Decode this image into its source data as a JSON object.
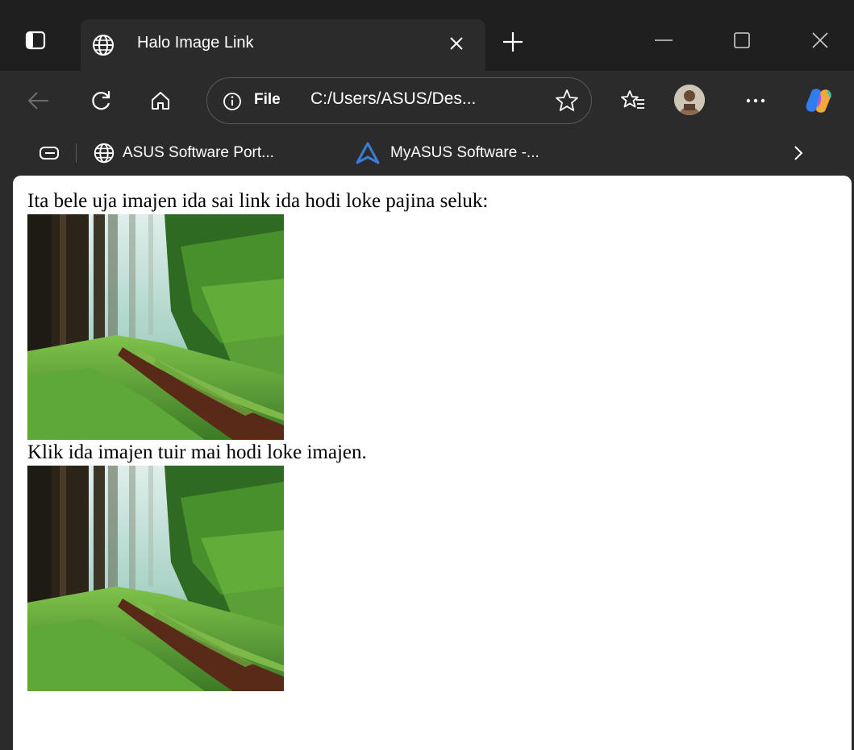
{
  "tab": {
    "title": "Halo Image Link"
  },
  "address": {
    "scheme": "File",
    "url": "C:/Users/ASUS/Des..."
  },
  "bookmarks": [
    {
      "label": "ASUS Software Port...",
      "icon": "globe-icon"
    },
    {
      "label": "MyASUS Software -...",
      "icon": "myasus-icon"
    }
  ],
  "page": {
    "line1": "Ita bele uja imajen ida sai link ida hodi loke pajina seluk:",
    "line2": "Klik ida imajen tuir mai hodi loke imajen."
  },
  "colors": {
    "titlebar": "#1f1f1f",
    "toolbar": "#2b2b2b",
    "accent": "#3a7bd5"
  }
}
